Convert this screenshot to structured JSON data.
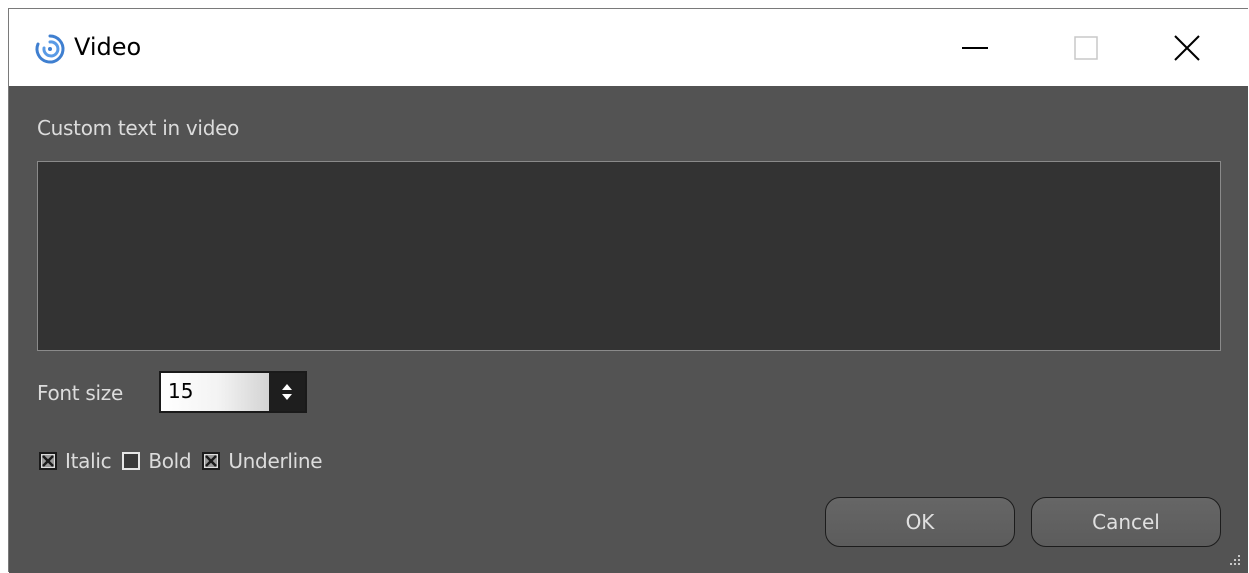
{
  "window": {
    "title": "Video"
  },
  "dialog": {
    "custom_text_label": "Custom text in video",
    "custom_text_value": "",
    "font_size_label": "Font size",
    "font_size_value": "15",
    "options": [
      {
        "label": "Italic",
        "checked": true
      },
      {
        "label": "Bold",
        "checked": false
      },
      {
        "label": "Underline",
        "checked": true
      }
    ],
    "ok_label": "OK",
    "cancel_label": "Cancel"
  },
  "colors": {
    "window_bg": "#535353",
    "text_area_bg": "#333333",
    "text_color": "#dcdcdc",
    "titlebar_bg": "#ffffff"
  }
}
